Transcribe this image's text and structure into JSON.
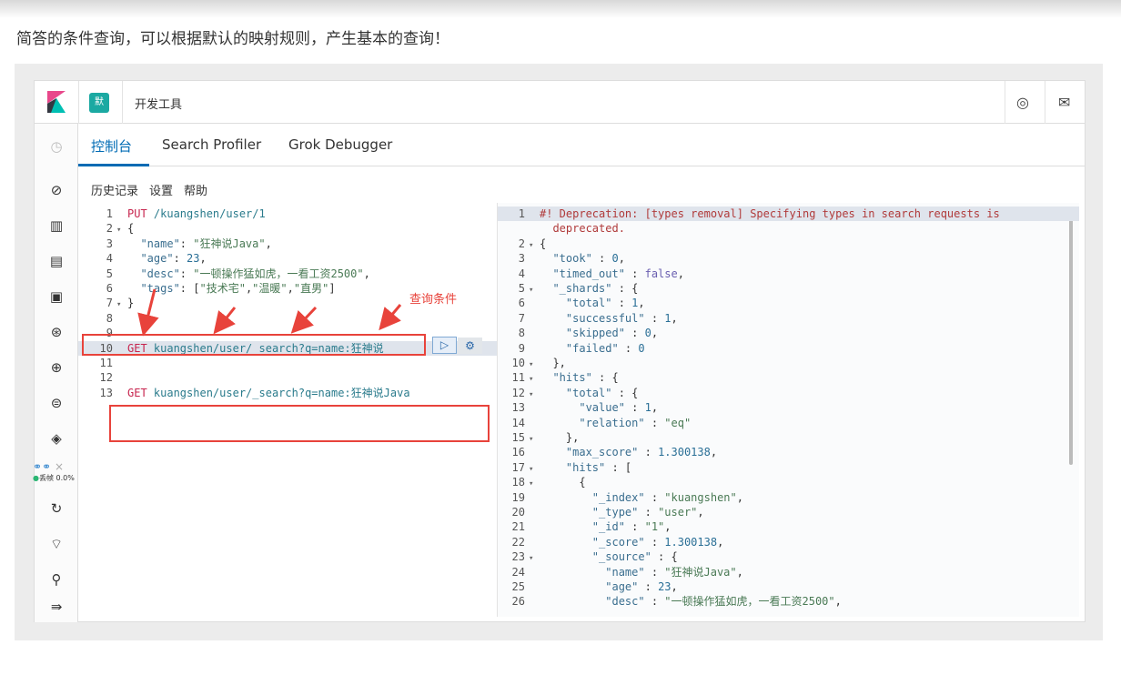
{
  "caption": "简答的条件查询，可以根据默认的映射规则，产生基本的查询！",
  "header": {
    "space_badge": "默",
    "title": "开发工具",
    "help_icon": "help-icon",
    "mail_icon": "mail-icon"
  },
  "tabs": [
    {
      "label": "控制台",
      "active": true
    },
    {
      "label": "Search Profiler"
    },
    {
      "label": "Grok Debugger"
    }
  ],
  "toolbar": {
    "history": "历史记录",
    "settings": "设置",
    "help": "帮助"
  },
  "annotation": "查询条件",
  "overlay": {
    "fps": "丢帧 0.0%",
    "close": "×"
  },
  "request_editor": [
    {
      "n": "1",
      "seg": [
        [
          "PUT ",
          "m"
        ],
        [
          "/kuangshen/user/1",
          "u"
        ]
      ]
    },
    {
      "n": "2",
      "f": true,
      "seg": [
        [
          "{",
          "p"
        ]
      ]
    },
    {
      "n": "3",
      "seg": [
        [
          "  \"name\"",
          "k"
        ],
        [
          ": ",
          "p"
        ],
        [
          "\"狂神说Java\"",
          "s"
        ],
        [
          ",",
          "p"
        ]
      ]
    },
    {
      "n": "4",
      "seg": [
        [
          "  \"age\"",
          "k"
        ],
        [
          ": ",
          "p"
        ],
        [
          "23",
          "n"
        ],
        [
          ",",
          "p"
        ]
      ]
    },
    {
      "n": "5",
      "seg": [
        [
          "  \"desc\"",
          "k"
        ],
        [
          ": ",
          "p"
        ],
        [
          "\"一顿操作猛如虎，一看工资2500\"",
          "s"
        ],
        [
          ",",
          "p"
        ]
      ]
    },
    {
      "n": "6",
      "seg": [
        [
          "  \"tags\"",
          "k"
        ],
        [
          ": [",
          "p"
        ],
        [
          "\"技术宅\"",
          "s"
        ],
        [
          ",",
          "p"
        ],
        [
          "\"温暖\"",
          "s"
        ],
        [
          ",",
          "p"
        ],
        [
          "\"直男\"",
          "s"
        ],
        [
          "]",
          "p"
        ]
      ]
    },
    {
      "n": "7",
      "f": true,
      "seg": [
        [
          "}",
          "p"
        ]
      ]
    },
    {
      "n": "8",
      "seg": []
    },
    {
      "n": "9",
      "seg": []
    },
    {
      "n": "10",
      "hl": true,
      "seg": [
        [
          "GET ",
          "m"
        ],
        [
          "kuangshen/user/_search?q=name:狂神说",
          "u"
        ]
      ]
    },
    {
      "n": "11",
      "seg": []
    },
    {
      "n": "12",
      "seg": []
    },
    {
      "n": "13",
      "seg": [
        [
          "GET ",
          "m"
        ],
        [
          "kuangshen/user/_search?q=name:狂神说Java",
          "u"
        ]
      ]
    }
  ],
  "response_editor": [
    {
      "n": "1",
      "hl": true,
      "seg": [
        [
          "#! Deprecation: [types removal] Specifying types in search requests is",
          "c"
        ]
      ]
    },
    {
      "n": "",
      "seg": [
        [
          "  deprecated.",
          "c"
        ]
      ]
    },
    {
      "n": "2",
      "f": true,
      "seg": [
        [
          "{",
          "p"
        ]
      ]
    },
    {
      "n": "3",
      "seg": [
        [
          "  \"took\"",
          "k"
        ],
        [
          " : ",
          "p"
        ],
        [
          "0",
          "n"
        ],
        [
          ",",
          "p"
        ]
      ]
    },
    {
      "n": "4",
      "seg": [
        [
          "  \"timed_out\"",
          "k"
        ],
        [
          " : ",
          "p"
        ],
        [
          "false",
          "b"
        ],
        [
          ",",
          "p"
        ]
      ]
    },
    {
      "n": "5",
      "f": true,
      "seg": [
        [
          "  \"_shards\"",
          "k"
        ],
        [
          " : {",
          "p"
        ]
      ]
    },
    {
      "n": "6",
      "seg": [
        [
          "    \"total\"",
          "k"
        ],
        [
          " : ",
          "p"
        ],
        [
          "1",
          "n"
        ],
        [
          ",",
          "p"
        ]
      ]
    },
    {
      "n": "7",
      "seg": [
        [
          "    \"successful\"",
          "k"
        ],
        [
          " : ",
          "p"
        ],
        [
          "1",
          "n"
        ],
        [
          ",",
          "p"
        ]
      ]
    },
    {
      "n": "8",
      "seg": [
        [
          "    \"skipped\"",
          "k"
        ],
        [
          " : ",
          "p"
        ],
        [
          "0",
          "n"
        ],
        [
          ",",
          "p"
        ]
      ]
    },
    {
      "n": "9",
      "seg": [
        [
          "    \"failed\"",
          "k"
        ],
        [
          " : ",
          "p"
        ],
        [
          "0",
          "n"
        ]
      ]
    },
    {
      "n": "10",
      "f": true,
      "seg": [
        [
          "  },",
          "p"
        ]
      ]
    },
    {
      "n": "11",
      "f": true,
      "seg": [
        [
          "  \"hits\"",
          "k"
        ],
        [
          " : {",
          "p"
        ]
      ]
    },
    {
      "n": "12",
      "f": true,
      "seg": [
        [
          "    \"total\"",
          "k"
        ],
        [
          " : {",
          "p"
        ]
      ]
    },
    {
      "n": "13",
      "seg": [
        [
          "      \"value\"",
          "k"
        ],
        [
          " : ",
          "p"
        ],
        [
          "1",
          "n"
        ],
        [
          ",",
          "p"
        ]
      ]
    },
    {
      "n": "14",
      "seg": [
        [
          "      \"relation\"",
          "k"
        ],
        [
          " : ",
          "p"
        ],
        [
          "\"eq\"",
          "s"
        ]
      ]
    },
    {
      "n": "15",
      "f": true,
      "seg": [
        [
          "    },",
          "p"
        ]
      ]
    },
    {
      "n": "16",
      "seg": [
        [
          "    \"max_score\"",
          "k"
        ],
        [
          " : ",
          "p"
        ],
        [
          "1.300138",
          "n"
        ],
        [
          ",",
          "p"
        ]
      ]
    },
    {
      "n": "17",
      "f": true,
      "seg": [
        [
          "    \"hits\"",
          "k"
        ],
        [
          " : [",
          "p"
        ]
      ]
    },
    {
      "n": "18",
      "f": true,
      "seg": [
        [
          "      {",
          "p"
        ]
      ]
    },
    {
      "n": "19",
      "seg": [
        [
          "        \"_index\"",
          "k"
        ],
        [
          " : ",
          "p"
        ],
        [
          "\"kuangshen\"",
          "s"
        ],
        [
          ",",
          "p"
        ]
      ]
    },
    {
      "n": "20",
      "seg": [
        [
          "        \"_type\"",
          "k"
        ],
        [
          " : ",
          "p"
        ],
        [
          "\"user\"",
          "s"
        ],
        [
          ",",
          "p"
        ]
      ]
    },
    {
      "n": "21",
      "seg": [
        [
          "        \"_id\"",
          "k"
        ],
        [
          " : ",
          "p"
        ],
        [
          "\"1\"",
          "s"
        ],
        [
          ",",
          "p"
        ]
      ]
    },
    {
      "n": "22",
      "seg": [
        [
          "        \"_score\"",
          "k"
        ],
        [
          " : ",
          "p"
        ],
        [
          "1.300138",
          "n"
        ],
        [
          ",",
          "p"
        ]
      ]
    },
    {
      "n": "23",
      "f": true,
      "seg": [
        [
          "        \"_source\"",
          "k"
        ],
        [
          " : {",
          "p"
        ]
      ]
    },
    {
      "n": "24",
      "seg": [
        [
          "          \"name\"",
          "k"
        ],
        [
          " : ",
          "p"
        ],
        [
          "\"狂神说Java\"",
          "s"
        ],
        [
          ",",
          "p"
        ]
      ]
    },
    {
      "n": "25",
      "seg": [
        [
          "          \"age\"",
          "k"
        ],
        [
          " : ",
          "p"
        ],
        [
          "23",
          "n"
        ],
        [
          ",",
          "p"
        ]
      ]
    },
    {
      "n": "26",
      "seg": [
        [
          "          \"desc\"",
          "k"
        ],
        [
          " : ",
          "p"
        ],
        [
          "\"一顿操作猛如虎，一看工资2500\"",
          "s"
        ],
        [
          ",",
          "p"
        ]
      ]
    }
  ],
  "colors": {
    "accent": "#006bb4",
    "annotation_red": "#e8433b",
    "space_badge": "#1ba9a2"
  }
}
